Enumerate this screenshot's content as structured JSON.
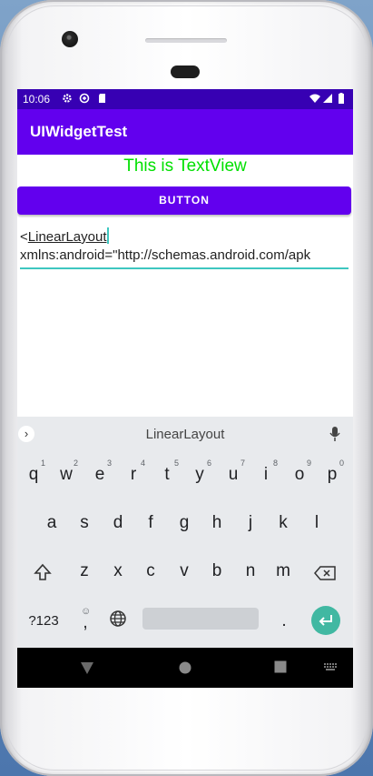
{
  "status_bar": {
    "time": "10:06"
  },
  "app_bar": {
    "title": "UIWidgetTest"
  },
  "main": {
    "text_view": "This is TextView",
    "button_label": "BUTTON",
    "edit_text": {
      "prefix": "<",
      "word": "LinearLayout",
      "line2": "xmlns:android=\"http://schemas.android.com/apk"
    }
  },
  "keyboard": {
    "suggestion": "LinearLayout",
    "row1": [
      "q",
      "w",
      "e",
      "r",
      "t",
      "y",
      "u",
      "i",
      "o",
      "p"
    ],
    "row1_hints": [
      "1",
      "2",
      "3",
      "4",
      "5",
      "6",
      "7",
      "8",
      "9",
      "0"
    ],
    "row2": [
      "a",
      "s",
      "d",
      "f",
      "g",
      "h",
      "j",
      "k",
      "l"
    ],
    "row3": [
      "z",
      "x",
      "c",
      "v",
      "b",
      "n",
      "m"
    ],
    "symbols_key": "?123",
    "comma": ",",
    "period": "."
  },
  "colors": {
    "primary": "#6200ee",
    "primary_dark": "#3700b3",
    "text_view": "#00e000",
    "accent": "#3ec7c0"
  }
}
